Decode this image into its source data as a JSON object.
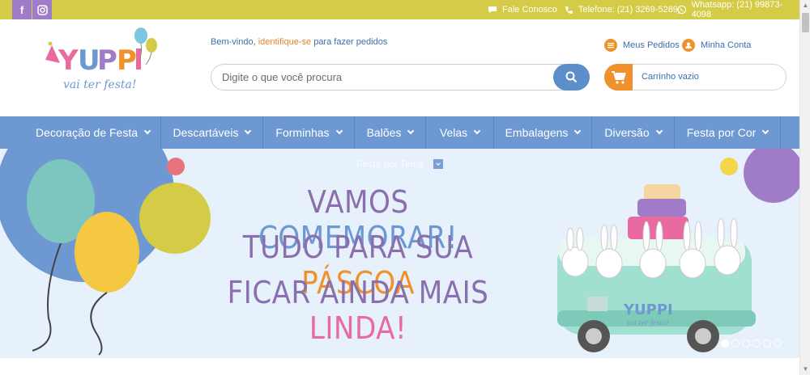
{
  "topbar": {
    "social": [
      {
        "name": "facebook",
        "icon": "f"
      },
      {
        "name": "instagram",
        "icon": "instagram-icon"
      }
    ],
    "fale_conosco": "Fale Conosco",
    "telefone": "Telefone: (21) 3269-5269",
    "whatsapp": "Whatsapp: (21) 99873-4098",
    "color": "#d4cc47"
  },
  "header": {
    "logo_text": "YUPPI",
    "logo_tagline": "vai ter festa!",
    "welcome_prefix": "Bem-vindo, ",
    "welcome_link": "identifique-se",
    "welcome_suffix": " para fazer pedidos",
    "search_placeholder": "Digite o que você procura",
    "meus_pedidos": "Meus Pedidos",
    "minha_conta": "Minha Conta",
    "cart_label": "Carrinho vazio"
  },
  "nav": {
    "items": [
      {
        "label": "Decoração de Festa"
      },
      {
        "label": "Descartáveis"
      },
      {
        "label": "Forminhas"
      },
      {
        "label": "Balões"
      },
      {
        "label": "Velas"
      },
      {
        "label": "Embalagens"
      },
      {
        "label": "Diversão"
      },
      {
        "label": "Festa por Cor"
      }
    ],
    "sub_item": "Festa por Tema",
    "color": "#6e98d2"
  },
  "banner": {
    "line1_a": "VAMOS ",
    "line1_b": "COMEMORAR!",
    "line2_a": "TUDO PARA SUA ",
    "line2_b": "PÁSCOA",
    "line3_a": "FICAR AINDA MAIS ",
    "line3_b": "LINDA!",
    "bus_logo": "YUPPI",
    "bus_tagline": "vai ter festa!",
    "slides_total": 6,
    "active_slide": 1
  }
}
